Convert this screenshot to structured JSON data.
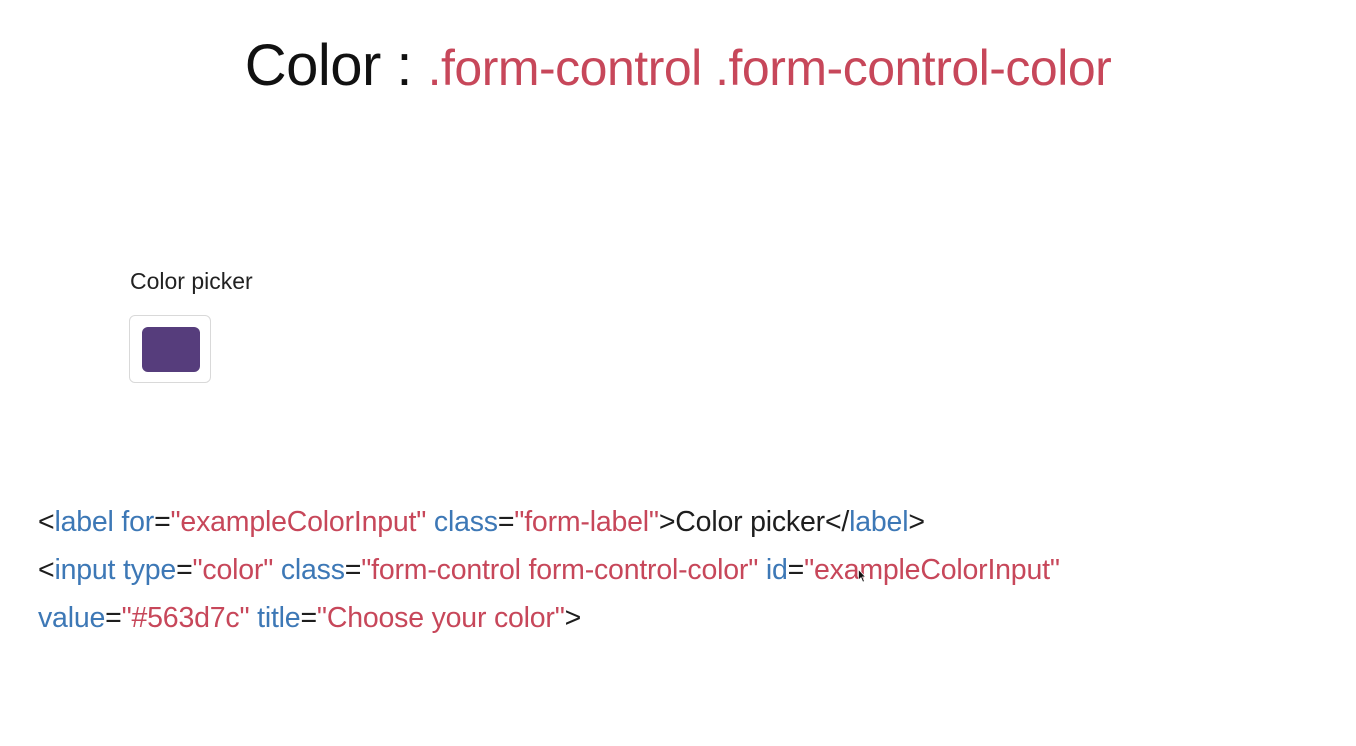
{
  "title": {
    "prefix": "Color : ",
    "classes": ".form-control .form-control-color"
  },
  "demo": {
    "label": "Color picker",
    "color_value": "#563d7c"
  },
  "code": {
    "line1": {
      "open_tag": "<",
      "tag": "label",
      "attr1": " for",
      "eq1": "=",
      "val1": "\"exampleColorInput\"",
      "attr2": " class",
      "eq2": "=",
      "val2": "\"form-label\"",
      "close_open": ">",
      "text": "Color picker",
      "end_open": "</",
      "end_tag": "label",
      "end_close": ">"
    },
    "line2": {
      "open_tag": "<",
      "tag": "input",
      "attr1": " type",
      "eq1": "=",
      "val1": "\"color\"",
      "attr2": " class",
      "eq2": "=",
      "val2": "\"form-control form-control-color\"",
      "attr3": " id",
      "eq3": "=",
      "val3": "\"exampleColorInput\""
    },
    "line3": {
      "attr1": "value",
      "eq1": "=",
      "val1": "\"#563d7c\"",
      "attr2": " title",
      "eq2": "=",
      "val2": "\"Choose your color\"",
      "close": ">"
    }
  },
  "colors": {
    "accent_red": "#c7475a",
    "code_blue": "#3d78b6",
    "swatch": "#563d7c"
  },
  "icons": {
    "cursor": "mouse-pointer-icon"
  }
}
